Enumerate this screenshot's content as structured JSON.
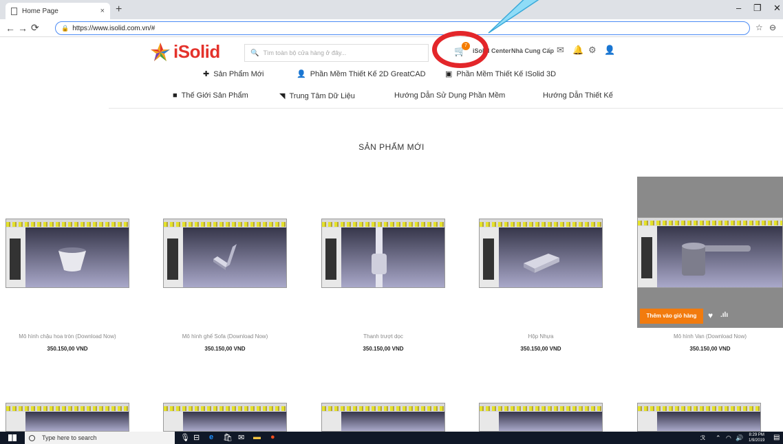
{
  "browser": {
    "tab_title": "Home Page",
    "tab_close": "×",
    "new_tab": "+",
    "url": "https://www.isolid.com.vn/#",
    "win_minimize": "–",
    "win_restore": "❐",
    "win_close": "✕"
  },
  "site": {
    "logo_text": "iSolid",
    "search_placeholder": "Tìm toàn bộ cửa hàng ở đây...",
    "cart_count": "7",
    "header_links": [
      "iSolid Center",
      "Nhà Cung Cấp"
    ],
    "menu_primary": [
      {
        "icon": "plus-icon",
        "label": "Sản Phẩm Mới"
      },
      {
        "icon": "user-icon",
        "label": "Phần Mềm Thiết Kế 2D GreatCAD"
      },
      {
        "icon": "image-icon",
        "label": "Phần Mềm Thiết Kế ISolid 3D"
      }
    ],
    "menu_secondary": [
      {
        "icon": "video-icon",
        "label": "Thế Giới Sản Phẩm"
      },
      {
        "icon": "rss-icon",
        "label": "Trung Tâm Dữ Liệu"
      },
      {
        "icon": "",
        "label": "Hướng Dẫn Sử Dụng Phần Mềm"
      },
      {
        "icon": "",
        "label": "Hướng Dẫn Thiết Kế"
      }
    ],
    "section_title": "SẢN PHẨM MỚI",
    "add_to_cart": "Thêm vào giỏ hàng"
  },
  "products": [
    {
      "name": "Mô hình chậu hoa tròn (Download Now)",
      "price": "350.150,00 VND"
    },
    {
      "name": "Mô hình ghế Sofa (Download Now)",
      "price": "350.150,00 VND"
    },
    {
      "name": "Thanh trượt dọc",
      "price": "350.150,00 VND"
    },
    {
      "name": "Hộp Nhựa",
      "price": "350.150,00 VND"
    },
    {
      "name": "Mô hình Van (Download Now)",
      "price": "350.150,00 VND"
    }
  ],
  "taskbar": {
    "search_placeholder": "Type here to search",
    "time": "8:29 PM",
    "date": "1/9/2019"
  },
  "colors": {
    "brand_red": "#e4322b",
    "accent_orange": "#f27b0e",
    "annotation_red": "#e3262a",
    "annotation_blue": "#5bc8f0"
  }
}
